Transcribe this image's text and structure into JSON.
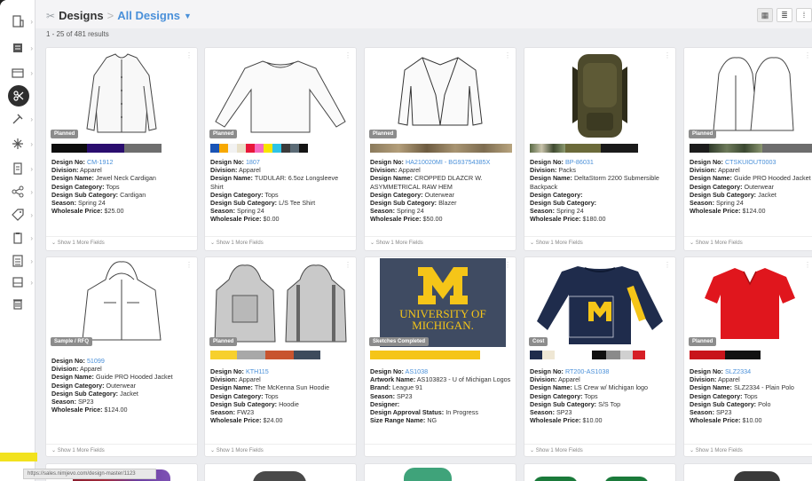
{
  "header": {
    "root_label": "Designs",
    "separator": ">",
    "current_view": "All Designs"
  },
  "results_text": "1 - 25 of 481 results",
  "labels": {
    "design_no": "Design No:",
    "division": "Division:",
    "design_name": "Design Name:",
    "design_category": "Design Category:",
    "design_sub_category": "Design Sub Category:",
    "season": "Season:",
    "wholesale_price": "Wholesale Price:",
    "artwork_name": "Artwork Name:",
    "brand": "Brand:",
    "designer": "Designer:",
    "design_approval_status": "Design Approval Status:",
    "size_range_name": "Size Range Name:",
    "show_more": "Show 1 More Fields"
  },
  "cards": [
    {
      "badge": "Planned",
      "design_no": "CM-1912",
      "division": "Apparel",
      "design_name": "Jewel Neck Cardigan",
      "design_category": "Tops",
      "design_sub_category": "Cardigan",
      "season": "Spring 24",
      "wholesale_price": "$25.00"
    },
    {
      "badge": "Planned",
      "design_no": "1807",
      "division": "Apparel",
      "design_name": "TUDULAR: 6.5oz Longsleeve Shirt",
      "design_category": "Tops",
      "design_sub_category": "L/S Tee Shirt",
      "season": "Spring 24",
      "wholesale_price": "$0.00"
    },
    {
      "badge": "Planned",
      "design_no": "HA210020MI - BG93754385X",
      "division": "Apparel",
      "design_name": "CROPPED DLAZCR W. ASYMMETRICAL RAW HEM",
      "design_category": "Outerwear",
      "design_sub_category": "Blazer",
      "season": "Spring 24",
      "wholesale_price": "$50.00"
    },
    {
      "badge": "",
      "design_no": "BP-86031",
      "division": "Packs",
      "design_name": "DeltaStorm 2200 Submersible Backpack",
      "design_category": "",
      "design_sub_category": "",
      "season": "Spring 24",
      "wholesale_price": "$180.00"
    },
    {
      "badge": "Planned",
      "design_no": "CTSKUIOUT0003",
      "division": "Apparel",
      "design_name": "Guide PRO Hooded Jacket",
      "design_category": "Outerwear",
      "design_sub_category": "Jacket",
      "season": "Spring 24",
      "wholesale_price": "$124.00"
    },
    {
      "badge": "Sample / RFQ",
      "design_no": "51099",
      "division": "Apparel",
      "design_name": "Guide PRO Hooded Jacket",
      "design_category": "Outerwear",
      "design_sub_category": "Jacket",
      "season": "SP23",
      "wholesale_price": "$124.00"
    },
    {
      "badge": "Planned",
      "design_no": "KTH115",
      "division": "Apparel",
      "design_name": "The McKenna Sun Hoodie",
      "design_category": "Tops",
      "design_sub_category": "Hoodie",
      "season": "FW23",
      "wholesale_price": "$24.00"
    },
    {
      "badge": "Sketches Completed",
      "design_no": "AS1038",
      "artwork_name": "AS103823 - U of Michigan Logos",
      "brand": "League 91",
      "season": "SP23",
      "designer": "",
      "design_approval_status": "In Progress",
      "size_range_name": "NG",
      "art_line1": "UNIVERSITY OF",
      "art_line2": "MICHIGAN."
    },
    {
      "badge": "Cost",
      "design_no": "RT200-AS1038",
      "division": "Apparel",
      "design_name": "LS Crew w/ Michigan logo",
      "design_category": "Tops",
      "design_sub_category": "S/S Top",
      "season": "SP23",
      "wholesale_price": "$10.00"
    },
    {
      "badge": "Planned",
      "design_no": "SLZ2334",
      "division": "Apparel",
      "design_name": "SLZ2334 - Plain Polo",
      "design_category": "Tops",
      "design_sub_category": "Polo",
      "season": "SP23",
      "wholesale_price": "$10.00"
    }
  ],
  "status_url": "https://sales.nimjevo.com/design-master/1123",
  "colors": {
    "accent": "#4a90d9",
    "badge": "#8c8c8c",
    "sidebar_active": "#2e2e2e"
  }
}
